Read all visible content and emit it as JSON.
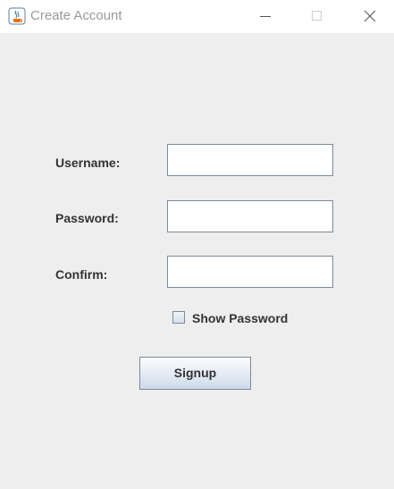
{
  "window": {
    "title": "Create Account",
    "controls": [
      "minimize-icon",
      "maximize-icon",
      "close-icon"
    ]
  },
  "form": {
    "username_label": "Username:",
    "username_value": "",
    "password_label": "Password:",
    "password_value": "",
    "confirm_label": "Confirm:",
    "confirm_value": "",
    "show_password_label": "Show Password",
    "show_password_checked": false,
    "signup_label": "Signup"
  },
  "colors": {
    "background": "#eeeeee",
    "titlebar": "#ffffff",
    "field_border": "#7a8a99",
    "label_text": "#333333"
  }
}
